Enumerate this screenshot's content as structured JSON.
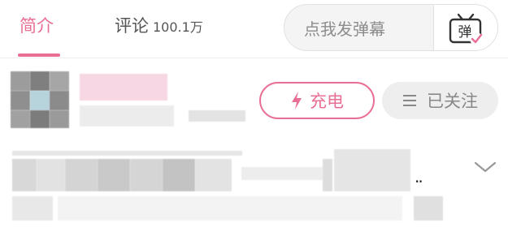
{
  "tabs": {
    "intro_label": "简介",
    "comments_label": "评论",
    "comments_count": "100.1万"
  },
  "danmaku": {
    "placeholder": "点我发弹幕",
    "icon_glyph": "弹",
    "icon": "danmaku-tv-icon"
  },
  "actions": {
    "charge_label": "充电",
    "charge_icon": "lightning-icon",
    "follow_label": "已关注",
    "follow_icon": "menu-lines-icon"
  },
  "description": {
    "ellipsis": "..",
    "expand_icon": "chevron-down-icon"
  },
  "colors": {
    "accent": "#e86f93",
    "muted_text": "#888888",
    "pill_bg": "#eeeeee"
  }
}
